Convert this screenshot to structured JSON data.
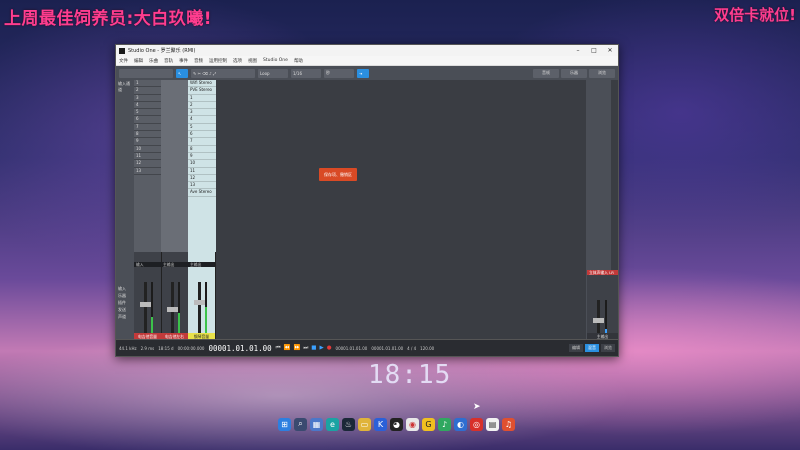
{
  "overlay": {
    "left_text": "上周最佳饲养员:大白玖曦!",
    "right_text": "双倍卡就位!"
  },
  "clock": "18:15",
  "window": {
    "title": "Studio One - 罗兰聚乐 (RMI)",
    "menu": [
      "文件",
      "编辑",
      "乐曲",
      "音轨",
      "事件",
      "音频",
      "运用控制",
      "选项",
      "视图",
      "Studio One",
      "帮助"
    ],
    "toolbar": {
      "snap": "Loop",
      "timebase": "1/16",
      "quantize": "秒",
      "right_buttons": [
        "音帧",
        "乐器",
        "浏览"
      ]
    },
    "input_label": "输入通道",
    "tracks_b": [
      "1",
      "2",
      "3",
      "4",
      "5",
      "6",
      "7",
      "8",
      "9",
      "10",
      "11",
      "12",
      "13"
    ],
    "tracks_d": [
      "Wifi Stereo",
      "PVE Stereo",
      "1",
      "2",
      "3",
      "4",
      "5",
      "6",
      "7",
      "8",
      "9",
      "10",
      "11",
      "12",
      "13",
      "Ave Stereo"
    ],
    "left_labels": [
      "输入",
      "乐器",
      "插件",
      "发送",
      "声道"
    ],
    "strip_labels": [
      "电吉他音量",
      "电吉他左右",
      "钢琴音量"
    ],
    "strip_titles": [
      "输入",
      "主输出",
      "主输出"
    ],
    "right_top": "立体声输入 LR",
    "right_label": "主输出",
    "popup_button": "保存项、撤销区",
    "transport": {
      "sample_rate": "44.1 kHz",
      "latency": "2.9 ms",
      "cpu": "18:15 d",
      "sec": "00:00:00.000",
      "position": "00001.01.01.00",
      "loop_start": "00001.01.01.00",
      "loop_end": "00001.01.01.00",
      "time_sig": "4 / 4",
      "tempo": "120.00",
      "right_buttons": [
        "编辑",
        "混音",
        "浏览"
      ]
    }
  },
  "taskbar": {
    "icons": [
      "windows-icon",
      "search-icon",
      "explorer-icon",
      "edge-icon",
      "steam-icon",
      "folder-icon",
      "kugou-icon",
      "qq-icon",
      "chrome-icon",
      "game-icon",
      "qq-music-icon",
      "tencent-icon",
      "netease-icon",
      "wechat-icon",
      "media-icon"
    ]
  }
}
